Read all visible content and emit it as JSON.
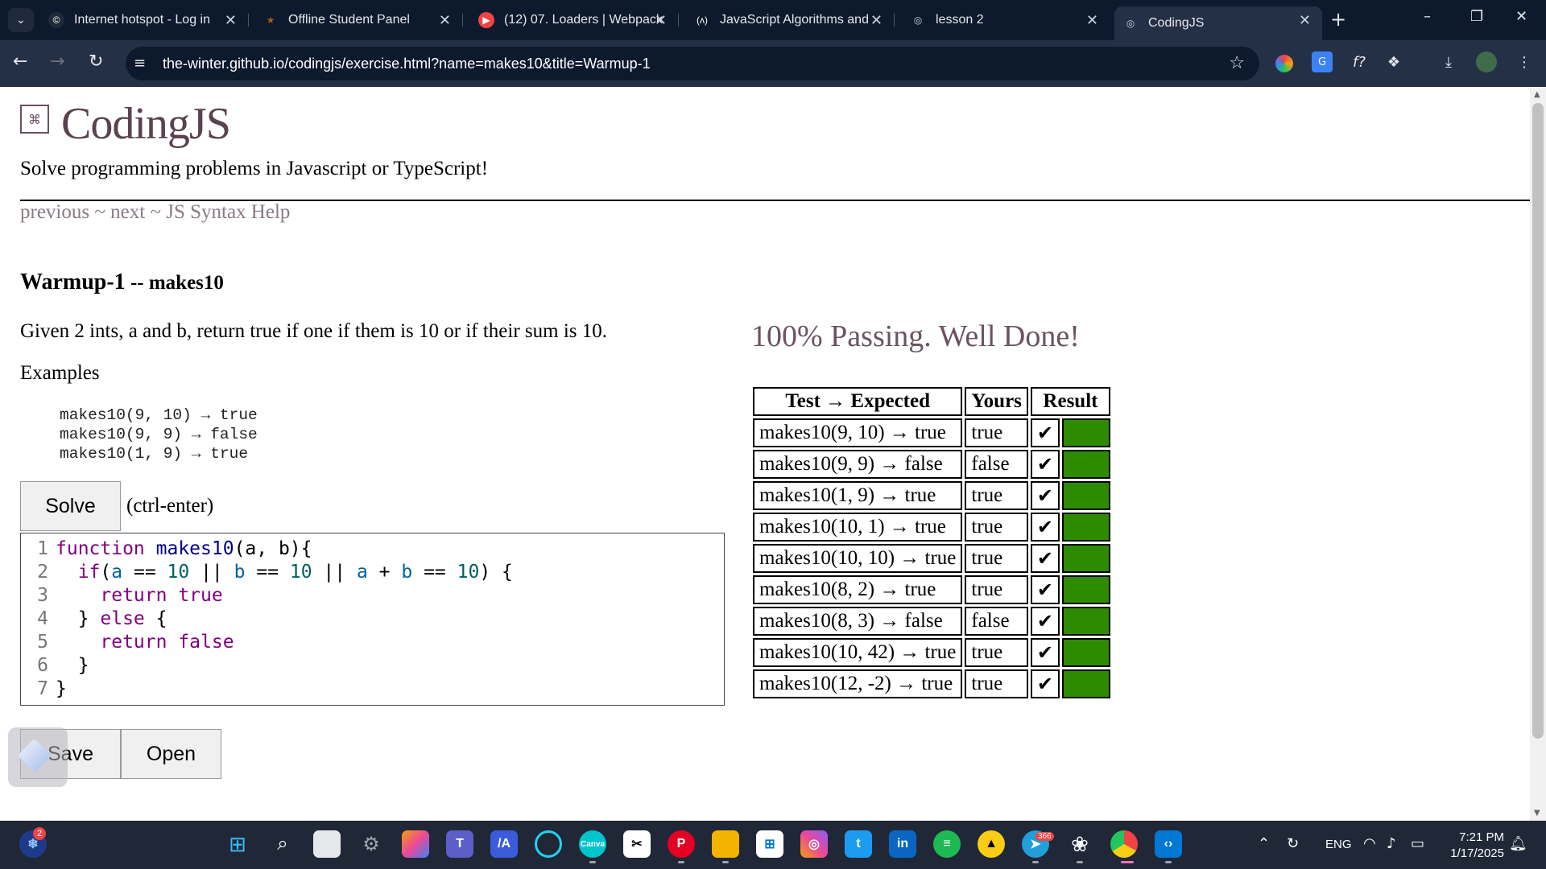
{
  "browser": {
    "tabs": [
      {
        "title": "Internet hotspot - Log in",
        "fav": "©",
        "fav_color": "#ffffff",
        "fav_bg": "#1f2937"
      },
      {
        "title": "Offline Student Panel",
        "fav": "★",
        "fav_color": "#a16207",
        "fav_bg": "transparent"
      },
      {
        "title": "(12) 07. Loaders | Webpack",
        "fav": "▶",
        "fav_color": "#ffffff",
        "fav_bg": "#ef4444"
      },
      {
        "title": "JavaScript Algorithms and",
        "fav": "(ʌ)",
        "fav_color": "#ffffff",
        "fav_bg": "transparent"
      },
      {
        "title": "lesson 2",
        "fav": "◎",
        "fav_color": "#cbd5e1",
        "fav_bg": "transparent"
      },
      {
        "title": "CodingJS",
        "fav": "◎",
        "fav_color": "#cbd5e1",
        "fav_bg": "transparent"
      }
    ],
    "url": "the-winter.github.io/codingjs/exercise.html?name=makes10&title=Warmup-1"
  },
  "site": {
    "title": "CodingJS",
    "tagline": "Solve programming problems in Javascript or TypeScript!",
    "nav_previous": "previous",
    "nav_sep": " ~ ",
    "nav_next": "next",
    "nav_help": "JS Syntax Help"
  },
  "exercise": {
    "category": "Warmup-1",
    "separator": " -- ",
    "name": "makes10",
    "prompt": "Given 2 ints, a and b, return true if one if them is 10 or if their sum is 10.",
    "examples_label": "Examples",
    "examples": "makes10(9, 10) → true\nmakes10(9, 9) → false\nmakes10(1, 9) → true"
  },
  "buttons": {
    "solve": "Solve",
    "solve_hint": "(ctrl-enter)",
    "save": "Save",
    "open": "Open"
  },
  "editor": {
    "lines": [
      {
        "n": "1",
        "segs": [
          [
            "kw",
            "function "
          ],
          [
            "fn",
            "makes10"
          ],
          [
            "",
            "(a, b){"
          ]
        ]
      },
      {
        "n": "2",
        "segs": [
          [
            "",
            "  "
          ],
          [
            "kw",
            "if"
          ],
          [
            "",
            "("
          ],
          [
            "var",
            "a"
          ],
          [
            "",
            " == "
          ],
          [
            "num",
            "10"
          ],
          [
            "",
            " || "
          ],
          [
            "var",
            "b"
          ],
          [
            "",
            " == "
          ],
          [
            "num",
            "10"
          ],
          [
            "",
            " || "
          ],
          [
            "var",
            "a"
          ],
          [
            "",
            " + "
          ],
          [
            "var",
            "b"
          ],
          [
            "",
            " == "
          ],
          [
            "num",
            "10"
          ],
          [
            "",
            ") {"
          ]
        ]
      },
      {
        "n": "3",
        "segs": [
          [
            "",
            "    "
          ],
          [
            "kw",
            "return true"
          ]
        ]
      },
      {
        "n": "4",
        "segs": [
          [
            "",
            "  } "
          ],
          [
            "kw",
            "else"
          ],
          [
            "",
            " {"
          ]
        ]
      },
      {
        "n": "5",
        "segs": [
          [
            "",
            "    "
          ],
          [
            "kw",
            "return false"
          ]
        ]
      },
      {
        "n": "6",
        "segs": [
          [
            "",
            "  }"
          ]
        ]
      },
      {
        "n": "7",
        "segs": [
          [
            "",
            "}"
          ]
        ]
      }
    ]
  },
  "results": {
    "summary": "100% Passing. Well Done!",
    "headers": [
      "Test → Expected",
      "Yours",
      "Result"
    ],
    "rows": [
      {
        "test": "makes10(9, 10) → true",
        "yours": "true",
        "mark": "✔"
      },
      {
        "test": "makes10(9, 9) → false",
        "yours": "false",
        "mark": "✔"
      },
      {
        "test": "makes10(1, 9) → true",
        "yours": "true",
        "mark": "✔"
      },
      {
        "test": "makes10(10, 1) → true",
        "yours": "true",
        "mark": "✔"
      },
      {
        "test": "makes10(10, 10) → true",
        "yours": "true",
        "mark": "✔"
      },
      {
        "test": "makes10(8, 2) → true",
        "yours": "true",
        "mark": "✔"
      },
      {
        "test": "makes10(8, 3) → false",
        "yours": "false",
        "mark": "✔"
      },
      {
        "test": "makes10(10, 42) → true",
        "yours": "true",
        "mark": "✔"
      },
      {
        "test": "makes10(12, -2) → true",
        "yours": "true",
        "mark": "✔"
      }
    ],
    "pass_color": "#2e8b00"
  },
  "taskbar": {
    "notification_count": "2",
    "telegram_badge": "366",
    "language": "ENG",
    "time": "7:21 PM",
    "date": "1/17/2025"
  }
}
